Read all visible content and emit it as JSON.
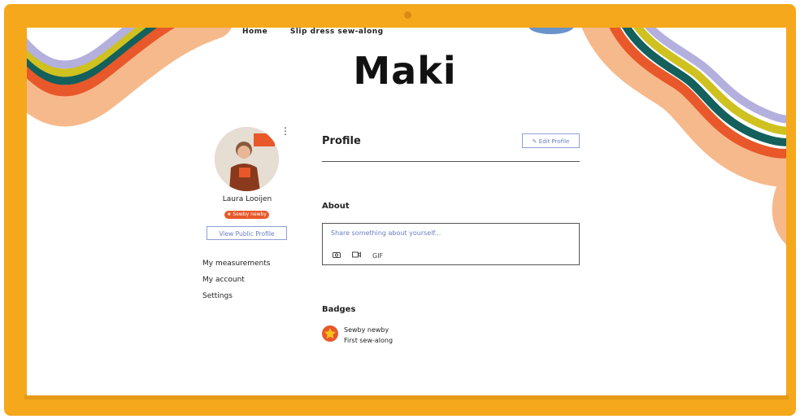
{
  "nav": {
    "items": [
      "Home",
      "Slip dress sew-along"
    ]
  },
  "brand": {
    "logo": "Maki"
  },
  "user": {
    "name": "Laura Looijen",
    "badge": "Sewby newby",
    "view_profile": "View Public Profile"
  },
  "side_menu": {
    "items": [
      "My measurements",
      "My account",
      "Settings"
    ]
  },
  "profile": {
    "title": "Profile",
    "edit_label": "Edit Profile"
  },
  "about": {
    "title": "About",
    "placeholder": "Share something about yourself...",
    "icons": [
      "camera-icon",
      "video-icon",
      "gif-icon"
    ],
    "gif_label": "GIF"
  },
  "badges": {
    "title": "Badges",
    "items": [
      {
        "name": "Sewby newby",
        "description": "First sew-along"
      }
    ]
  },
  "colors": {
    "frame": "#f5a81c",
    "accent_orange": "#e8582a",
    "link_blue": "#6a7ec4",
    "wave_teal": "#13605c",
    "wave_lilac": "#b3b0dd",
    "wave_yellow": "#cfc11f",
    "wave_peach": "#f6b98c"
  }
}
